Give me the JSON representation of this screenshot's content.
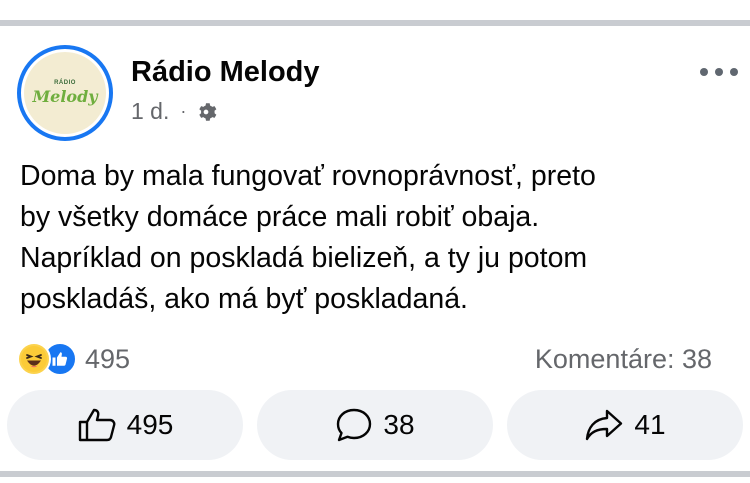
{
  "post": {
    "author": "Rádio Melody",
    "avatar_logo_top": "RÁDIO",
    "avatar_logo_main": "Melody",
    "time": "1 d.",
    "separator": "·",
    "privacy_icon": "gear-icon",
    "more_icon": "more-dots-icon",
    "text_lines": [
      "Doma by mala fungovať rovnoprávnosť, preto",
      "by všetky domáce práce mali robiť obaja.",
      "Napríklad on poskladá bielizeň, a ty ju potom",
      "poskladáš, ako má byť poskladaná."
    ]
  },
  "stats": {
    "reaction_icons": [
      "haha-icon",
      "like-icon"
    ],
    "reaction_count": "495",
    "comments_text": "Komentáre: 38"
  },
  "actions": {
    "like": {
      "icon": "thumbs-up-icon",
      "label": "495"
    },
    "comment": {
      "icon": "comment-bubble-icon",
      "label": "38"
    },
    "share": {
      "icon": "share-arrow-icon",
      "label": "41"
    }
  },
  "colors": {
    "accent": "#1877f2",
    "secondary_text": "#65676b",
    "button_bg": "#f0f2f5",
    "separator": "#c9ccd1"
  }
}
